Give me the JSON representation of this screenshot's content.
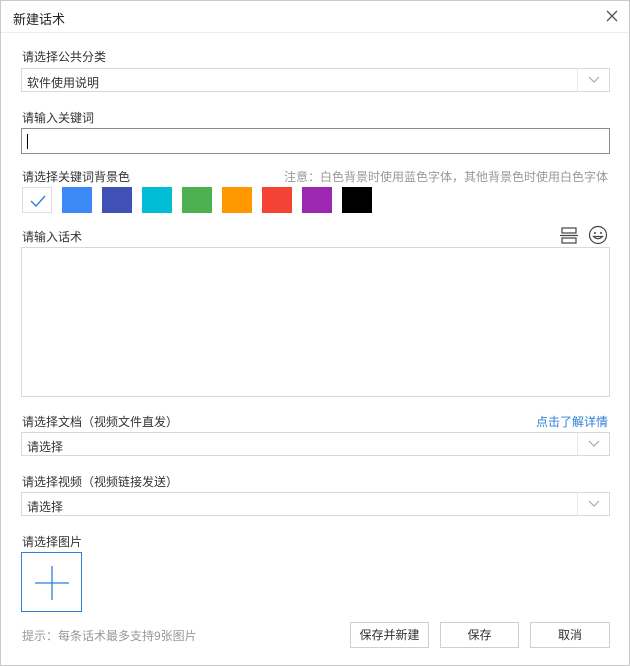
{
  "dialog": {
    "title": "新建话术",
    "close_icon": "close-icon"
  },
  "category": {
    "label": "请选择公共分类",
    "selected": "软件使用说明"
  },
  "keyword": {
    "label": "请输入关键词",
    "value": ""
  },
  "bg_color": {
    "label": "请选择关键词背景色",
    "note": "注意：白色背景时使用蓝色字体，其他背景色时使用白色字体",
    "options": [
      "#ffffff",
      "#3d8af7",
      "#3f51b5",
      "#00bcd4",
      "#4caf50",
      "#ff9800",
      "#f44336",
      "#9c27b0",
      "#000000"
    ],
    "selected_index": 0
  },
  "script": {
    "label": "请输入话术",
    "toolbar_icons": [
      "insert-divider-icon",
      "emoji-icon"
    ]
  },
  "document": {
    "label": "请选择文档（视频文件直发）",
    "link": "点击了解详情",
    "selected": "请选择"
  },
  "video": {
    "label": "请选择视频（视频链接发送）",
    "selected": "请选择"
  },
  "image": {
    "label": "请选择图片",
    "hint": "提示：每条话术最多支持9张图片"
  },
  "buttons": {
    "save_new": "保存并新建",
    "save": "保存",
    "cancel": "取消"
  },
  "colors": {
    "accent": "#2f7fd8",
    "muted": "#999999"
  }
}
